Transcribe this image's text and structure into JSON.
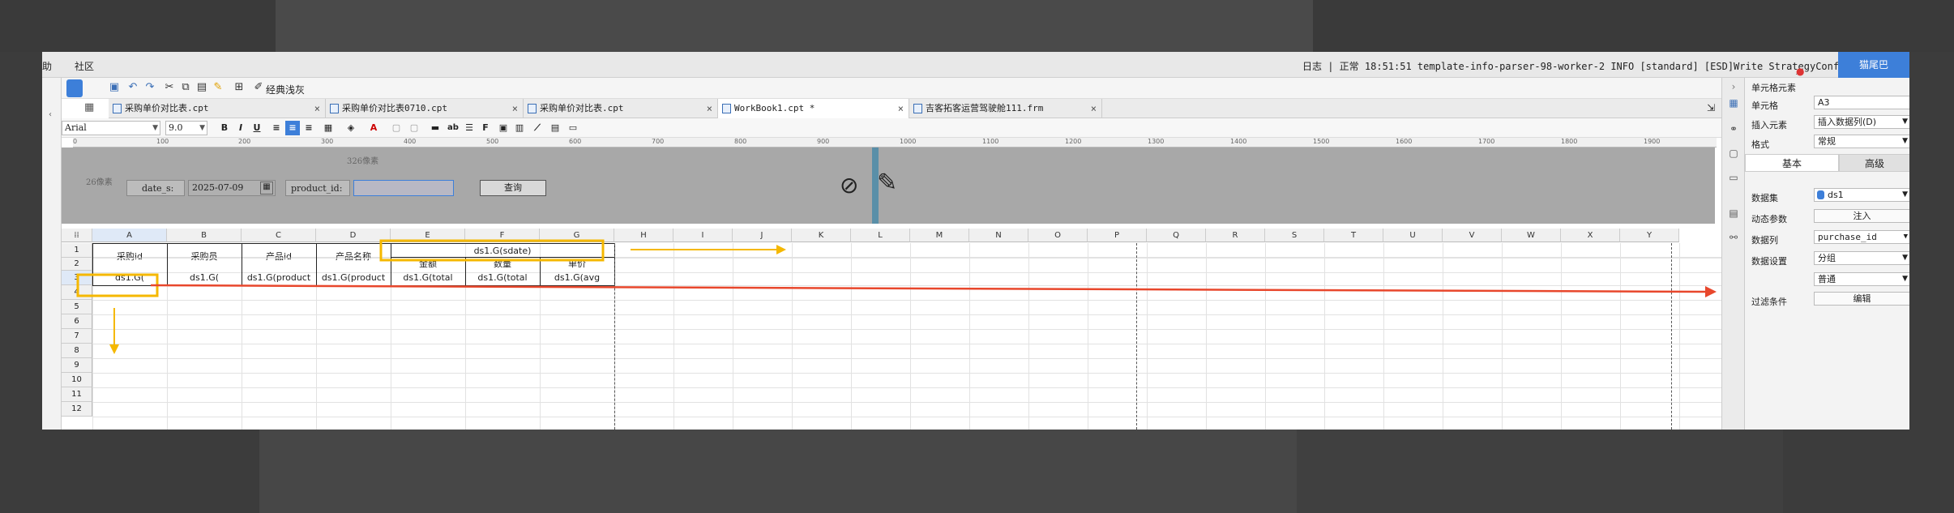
{
  "menubar": {
    "help": "助",
    "community": "社区",
    "log": "日志 | 正常 18:51:51 template-info-parser-98-worker-2 INFO [standard] [ESD]Write StrategyConfigsA...",
    "user": "猫尾巴"
  },
  "toolbar": {
    "classic_paste": "经典浅灰"
  },
  "tabs": [
    {
      "label": "采购单价对比表.cpt",
      "active": false
    },
    {
      "label": "采购单价对比表0710.cpt",
      "active": false
    },
    {
      "label": "采购单价对比表.cpt",
      "active": false
    },
    {
      "label": "WorkBook1.cpt *",
      "active": true
    },
    {
      "label": "吉客拓客运营驾驶舱111.frm",
      "active": false
    }
  ],
  "format": {
    "font": "Arial",
    "size": "9.0"
  },
  "ruler_ticks": [
    "0",
    "100",
    "200",
    "300",
    "400",
    "500",
    "600",
    "700",
    "800",
    "900",
    "1000",
    "1100",
    "1200",
    "1300",
    "1400",
    "1500",
    "1600",
    "1700",
    "1800",
    "1900"
  ],
  "params": {
    "height_label": "26像素",
    "width_label": "326像素",
    "date_label": "date_s:",
    "date_value": "2025-07-09",
    "product_label": "product_id:",
    "query_button": "查询"
  },
  "columns": [
    "A",
    "B",
    "C",
    "D",
    "E",
    "F",
    "G",
    "H",
    "I",
    "J",
    "K",
    "L",
    "M",
    "N",
    "O",
    "P",
    "Q",
    "R",
    "S",
    "T",
    "U",
    "V",
    "W",
    "X",
    "Y"
  ],
  "rows": [
    "1",
    "2",
    "3",
    "4",
    "5",
    "6",
    "7",
    "8",
    "9",
    "10",
    "11",
    "12"
  ],
  "cells": {
    "a1": "采购id",
    "b1": "采购员",
    "c1": "产品id",
    "d1": "产品名称",
    "efg1": "ds1.G(sdate)",
    "e2": "金额",
    "f2": "数量",
    "g2": "单价",
    "a3": "ds1.G(",
    "b3": "ds1.G(",
    "c3": "ds1.G(product",
    "d3": "ds1.G(product",
    "e3": "ds1.G(total",
    "f3": "ds1.G(total",
    "g3": "ds1.G(avg"
  },
  "panel": {
    "title": "单元格元素",
    "cell_label": "单元格",
    "cell_value": "A3",
    "insert_label": "插入元素",
    "insert_value": "插入数据列(D)",
    "format_label": "格式",
    "format_value": "常规",
    "tab_basic": "基本",
    "tab_advanced": "高级",
    "dataset_label": "数据集",
    "dataset_value": "ds1",
    "dynamic_label": "动态参数",
    "dynamic_button": "注入",
    "column_label": "数据列",
    "column_value": "purchase_id",
    "setting_label": "数据设置",
    "setting_value": "分组",
    "setting_sub": "普通",
    "filter_label": "过滤条件",
    "filter_button": "编辑"
  },
  "colors": {
    "accent": "#3d7fd9",
    "annotation_yellow": "#f5b800",
    "annotation_red": "#e8472c"
  }
}
